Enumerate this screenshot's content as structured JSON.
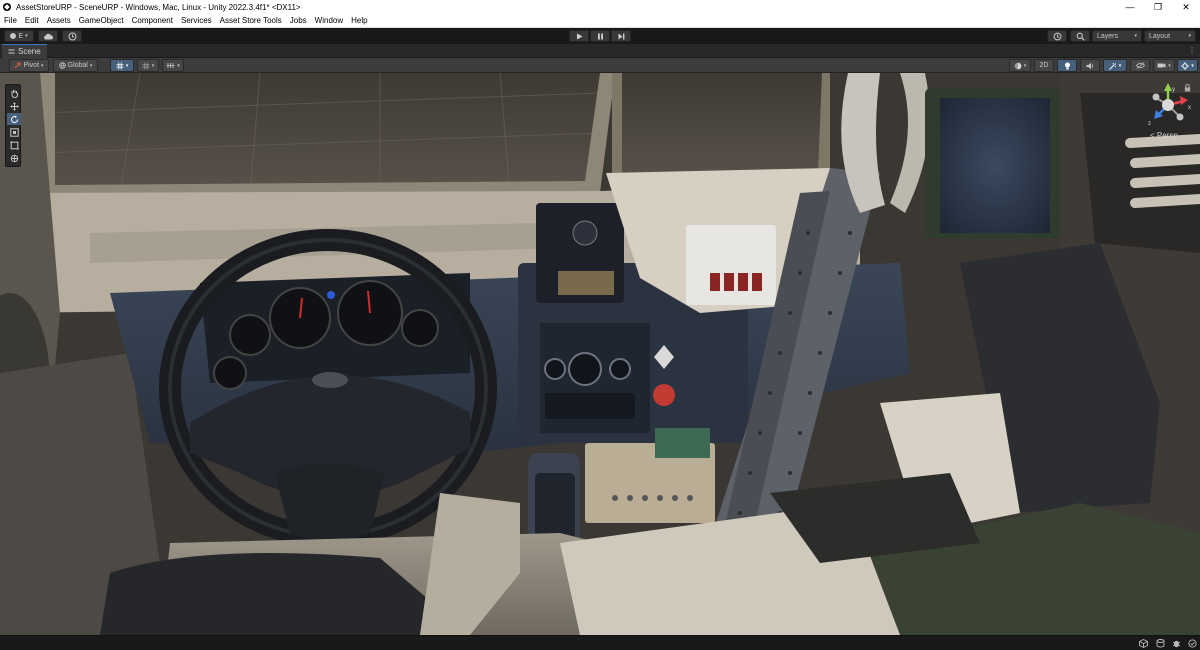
{
  "window": {
    "title": "AssetStoreURP - SceneURP - Windows, Mac, Linux - Unity 2022.3.4f1* <DX11>",
    "minimize": "—",
    "restore": "❐",
    "close": "✕"
  },
  "menu": [
    "File",
    "Edit",
    "Assets",
    "GameObject",
    "Component",
    "Services",
    "Asset Store Tools",
    "Jobs",
    "Window",
    "Help"
  ],
  "toolbar": {
    "account_label": "E",
    "layers_label": "Layers",
    "layout_label": "Layout"
  },
  "scene_tab": {
    "label": "Scene"
  },
  "scene_toolbar": {
    "pivot_label": "Pivot",
    "global_label": "Global",
    "two_d_label": "2D"
  },
  "gizmo": {
    "projection_label": "< Persp",
    "axis_x": "x",
    "axis_y": "y",
    "axis_z": "z"
  },
  "colors": {
    "accent": "#46607c",
    "tab_highlight": "#3a79bb",
    "editor_bg": "#191919",
    "panel_bg": "#3c3c3c"
  },
  "icons": {
    "hand_tool": "hand-icon",
    "move_tool": "move-icon",
    "rotate_tool": "rotate-icon",
    "scale_tool": "scale-icon",
    "rect_tool": "rect-icon",
    "transform_tool": "transform-icon"
  }
}
